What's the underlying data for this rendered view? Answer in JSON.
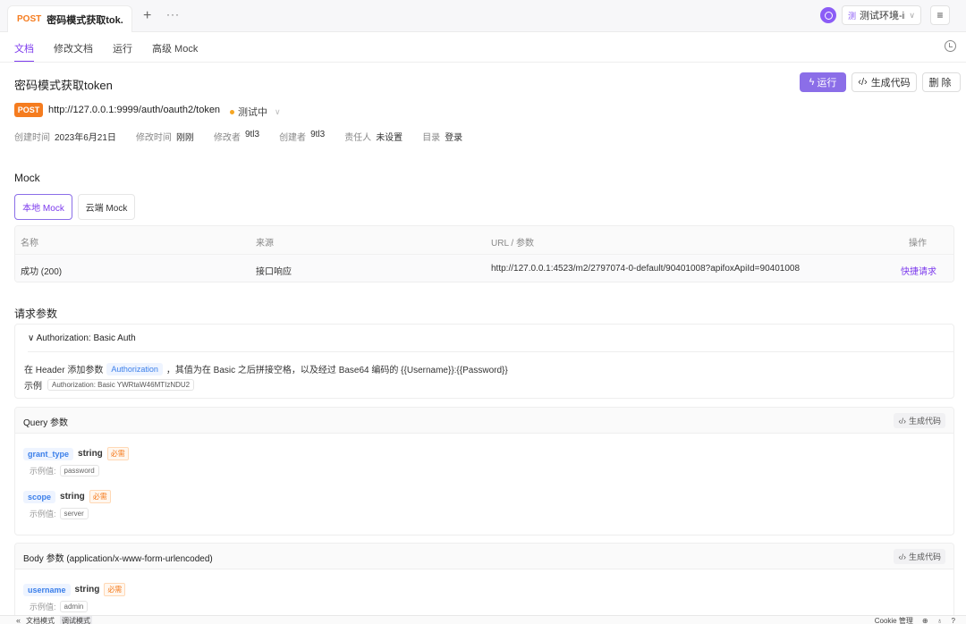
{
  "topbar": {
    "tab_method": "POST",
    "tab_name": "密码模式获取tok...",
    "plus": "+",
    "more": "···",
    "env_icon": "测",
    "env_name": "测试环境-inhos",
    "env_chevron": "∨",
    "menu_icon": "≡"
  },
  "subtabs": [
    "文档",
    "修改文档",
    "运行",
    "高级 Mock"
  ],
  "header": {
    "title": "密码模式获取token",
    "run_label": "运行",
    "run_icon": "ϟ",
    "code_label": "生成代码",
    "code_icon": "‹/›",
    "delete_label": "删除"
  },
  "request": {
    "method": "POST",
    "url": "http://127.0.0.1:9999/auth/oauth2/token",
    "status": "测试中",
    "status_chevron": "∨"
  },
  "meta": [
    {
      "k": "创建时间",
      "v": "2023年6月21日"
    },
    {
      "k": "修改时间",
      "v": "刚刚"
    },
    {
      "k": "修改者",
      "v": "9tl3"
    },
    {
      "k": "创建者",
      "v": "9tl3"
    },
    {
      "k": "责任人",
      "v": "未设置"
    },
    {
      "k": "目录",
      "v": "登录"
    }
  ],
  "mock": {
    "title": "Mock",
    "tabs": [
      "本地 Mock",
      "云端 Mock"
    ],
    "columns": [
      "名称",
      "来源",
      "URL / 参数",
      "操作"
    ],
    "row": {
      "name": "成功 (200)",
      "source": "接口响应",
      "url": "http://127.0.0.1:4523/m2/2797074-0-default/90401008?apifoxApiId=90401008",
      "action": "快捷请求"
    }
  },
  "params": {
    "title": "请求参数",
    "auth": {
      "head_arrow": "∨",
      "head": "Authorization: Basic Auth",
      "line_prefix": "在 Header 添加参数",
      "line_tag": "Authorization",
      "line_suffix": "，其值为在 Basic 之后拼接空格，以及经过 Base64 编码的 {{Username}}:{{Password}}",
      "example_label": "示例",
      "example_value": "Authorization: Basic YWRtaW46MTIzNDU2"
    },
    "gen_code": "生成代码",
    "gen_icon": "‹/›",
    "query": {
      "title": "Query 参数",
      "items": [
        {
          "name": "grant_type",
          "type": "string",
          "required": "必需",
          "example_label": "示例值:",
          "example": "password"
        },
        {
          "name": "scope",
          "type": "string",
          "required": "必需",
          "example_label": "示例值:",
          "example": "server"
        }
      ]
    },
    "body": {
      "title": "Body 参数 (application/x-www-form-urlencoded)",
      "items": [
        {
          "name": "username",
          "type": "string",
          "required": "必需",
          "example_label": "示例值:",
          "example": "admin"
        }
      ]
    }
  },
  "bottom": {
    "collapse": "«",
    "mode_doc": "文档模式",
    "mode_debug": "调试模式",
    "cookie": "Cookie 管理"
  }
}
